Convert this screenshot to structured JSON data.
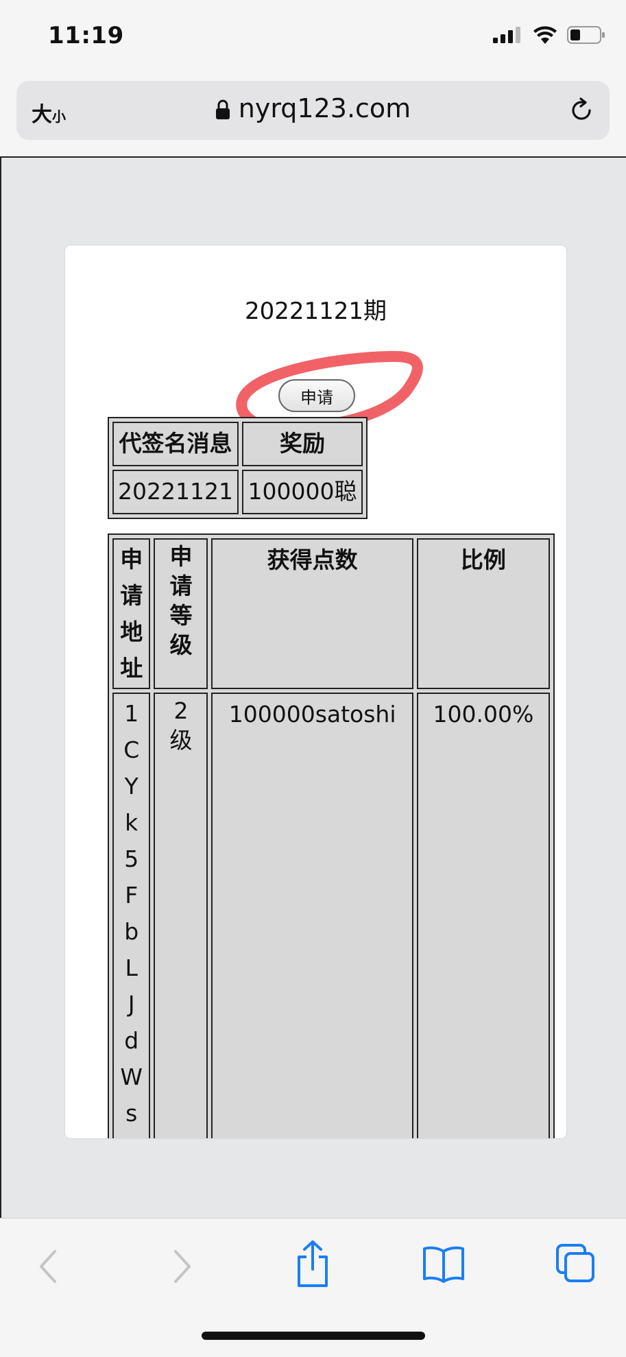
{
  "status_bar": {
    "time": "11:19"
  },
  "address_bar": {
    "text_size_big": "大",
    "text_size_small": "小",
    "url": "nyrq123.com"
  },
  "page": {
    "period_title": "20221121期",
    "apply_button": "申请",
    "summary_table": {
      "headers": [
        "代签名消息",
        "奖励"
      ],
      "row": [
        "20221121",
        "100000聪"
      ]
    },
    "detail_table": {
      "headers": {
        "address_chars": [
          "申",
          "请",
          "地",
          "址"
        ],
        "level": "申请等级",
        "points": "获得点数",
        "ratio": "比例"
      },
      "row": {
        "address_chars": [
          "1",
          "C",
          "Y",
          "k",
          "5",
          "F",
          "b",
          "L",
          "J",
          "d",
          "W",
          "s"
        ],
        "level": "2级",
        "points": "100000satoshi",
        "ratio": "100.00%"
      }
    }
  },
  "colors": {
    "accent": "#1a7ef5",
    "annotation": "#f05a5e"
  }
}
